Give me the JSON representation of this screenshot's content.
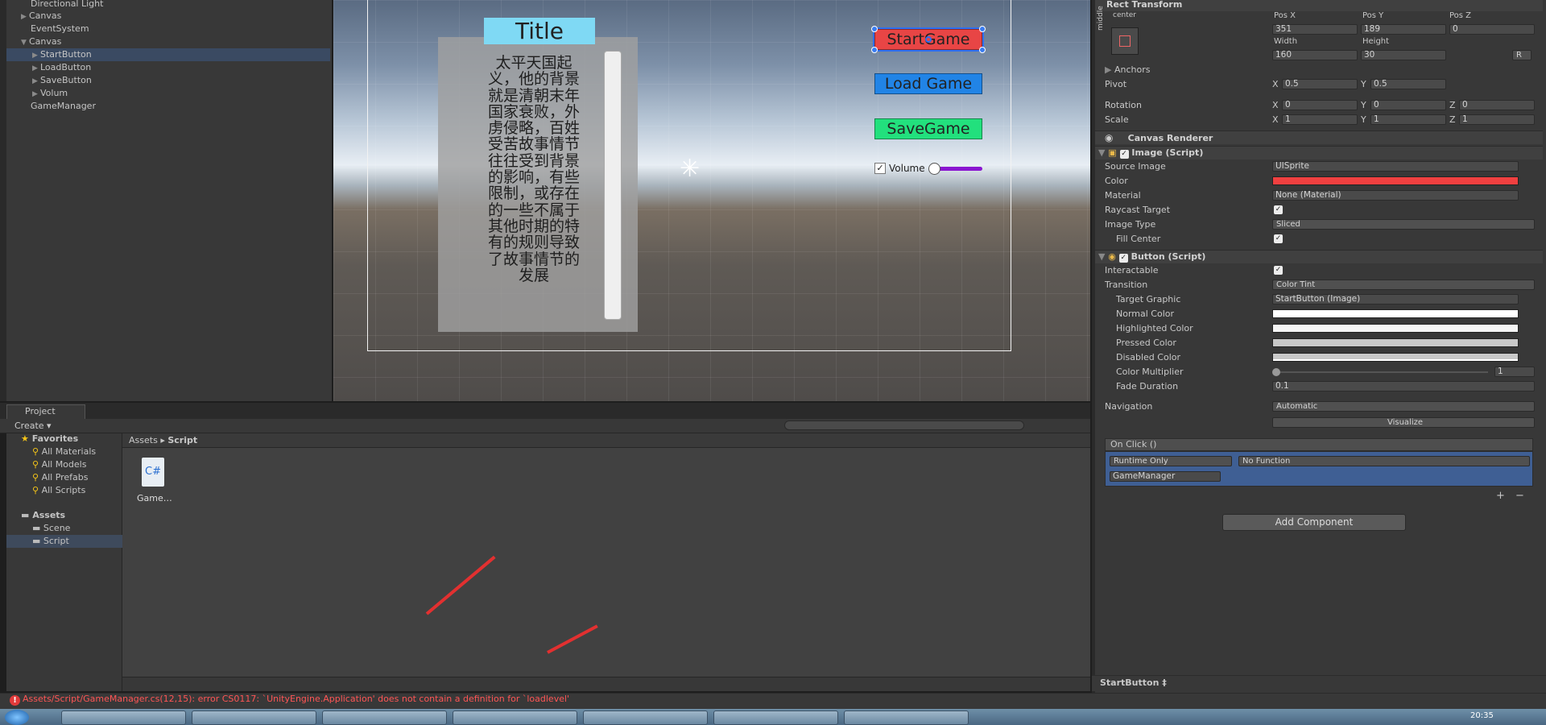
{
  "hierarchy": {
    "items": [
      {
        "label": "Directional Light",
        "arrow": ""
      },
      {
        "label": "Canvas",
        "arrow": "▶"
      },
      {
        "label": "EventSystem",
        "arrow": ""
      },
      {
        "label": "Canvas",
        "arrow": "▼"
      },
      {
        "label": "StartButton",
        "arrow": "▶"
      },
      {
        "label": "LoadButton",
        "arrow": "▶"
      },
      {
        "label": "SaveButton",
        "arrow": "▶"
      },
      {
        "label": "Volum",
        "arrow": "▶"
      },
      {
        "label": "GameManager",
        "arrow": ""
      }
    ]
  },
  "scene": {
    "title": "Title",
    "story": "太平天国起义，他的背景就是清朝末年国家衰败，外虏侵略，百姓受苦故事情节往往受到背景的影响，有些限制，或存在的一些不属于其他时期的特有的规则导致了故事情节的发展",
    "start_button": "StartGame",
    "load_button": "Load Game",
    "save_button": "SaveGame",
    "volume_label": "Volume",
    "volume_check": "✓",
    "volume_level": 0.1,
    "sun_glyph": "✳"
  },
  "project": {
    "tab": "Project",
    "create": "Create ▾",
    "favorites_title": "Favorites",
    "favorites": [
      "All Materials",
      "All Models",
      "All Prefabs",
      "All Scripts"
    ],
    "assets_title": "Assets",
    "folders": [
      "Scene",
      "Script"
    ],
    "breadcrumb": [
      "Assets",
      "▸",
      "Script"
    ],
    "file_icon": "C#",
    "file_label": "Game…"
  },
  "status": {
    "error_icon": "!",
    "error": "Assets/Script/GameManager.cs(12,15): error CS0117: `UnityEngine.Application' does not contain a definition for `loadlevel'"
  },
  "taskbar": {
    "clock": "20:35"
  },
  "inspector": {
    "rect_transform": "Rect Transform",
    "anchor_h": "center",
    "anchor_v": "middle",
    "pos_x_label": "Pos X",
    "pos_y_label": "Pos Y",
    "pos_z_label": "Pos Z",
    "pos_x": "351",
    "pos_y": "189",
    "pos_z": "0",
    "width_label": "Width",
    "height_label": "Height",
    "width": "160",
    "height": "30",
    "r_button": "R",
    "anchors": "Anchors",
    "pivot": "Pivot",
    "pivot_x": "0.5",
    "pivot_y": "0.5",
    "rotation": "Rotation",
    "rot_x": "0",
    "rot_y": "0",
    "rot_z": "0",
    "scale": "Scale",
    "scale_x": "1",
    "scale_y": "1",
    "scale_z": "1",
    "x": "X",
    "y": "Y",
    "z": "Z",
    "canvas_renderer": "Canvas Renderer",
    "image_script": "Image (Script)",
    "source_image": "Source Image",
    "source_image_val": "UISprite",
    "color": "Color",
    "color_hex": "#f04040",
    "material": "Material",
    "material_val": "None (Material)",
    "raycast": "Raycast Target",
    "image_type": "Image Type",
    "image_type_val": "Sliced",
    "fill_center": "Fill Center",
    "button_script": "Button (Script)",
    "interactable": "Interactable",
    "transition": "Transition",
    "transition_val": "Color Tint",
    "target_graphic": "Target Graphic",
    "target_graphic_val": "StartButton (Image)",
    "normal_color": "Normal Color",
    "highlighted_color": "Highlighted Color",
    "pressed_color": "Pressed Color",
    "disabled_color": "Disabled Color",
    "color_multiplier": "Color Multiplier",
    "color_multiplier_val": "1",
    "fade_duration": "Fade Duration",
    "fade_duration_val": "0.1",
    "navigation": "Navigation",
    "navigation_val": "Automatic",
    "visualize": "Visualize",
    "on_click": "On Click ()",
    "runtime_only": "Runtime Only",
    "no_function": "No Function",
    "game_manager": "GameManager",
    "plus": "+",
    "minus": "−",
    "add_component": "Add Component",
    "footer": "StartButton ‡",
    "check": "✓"
  }
}
